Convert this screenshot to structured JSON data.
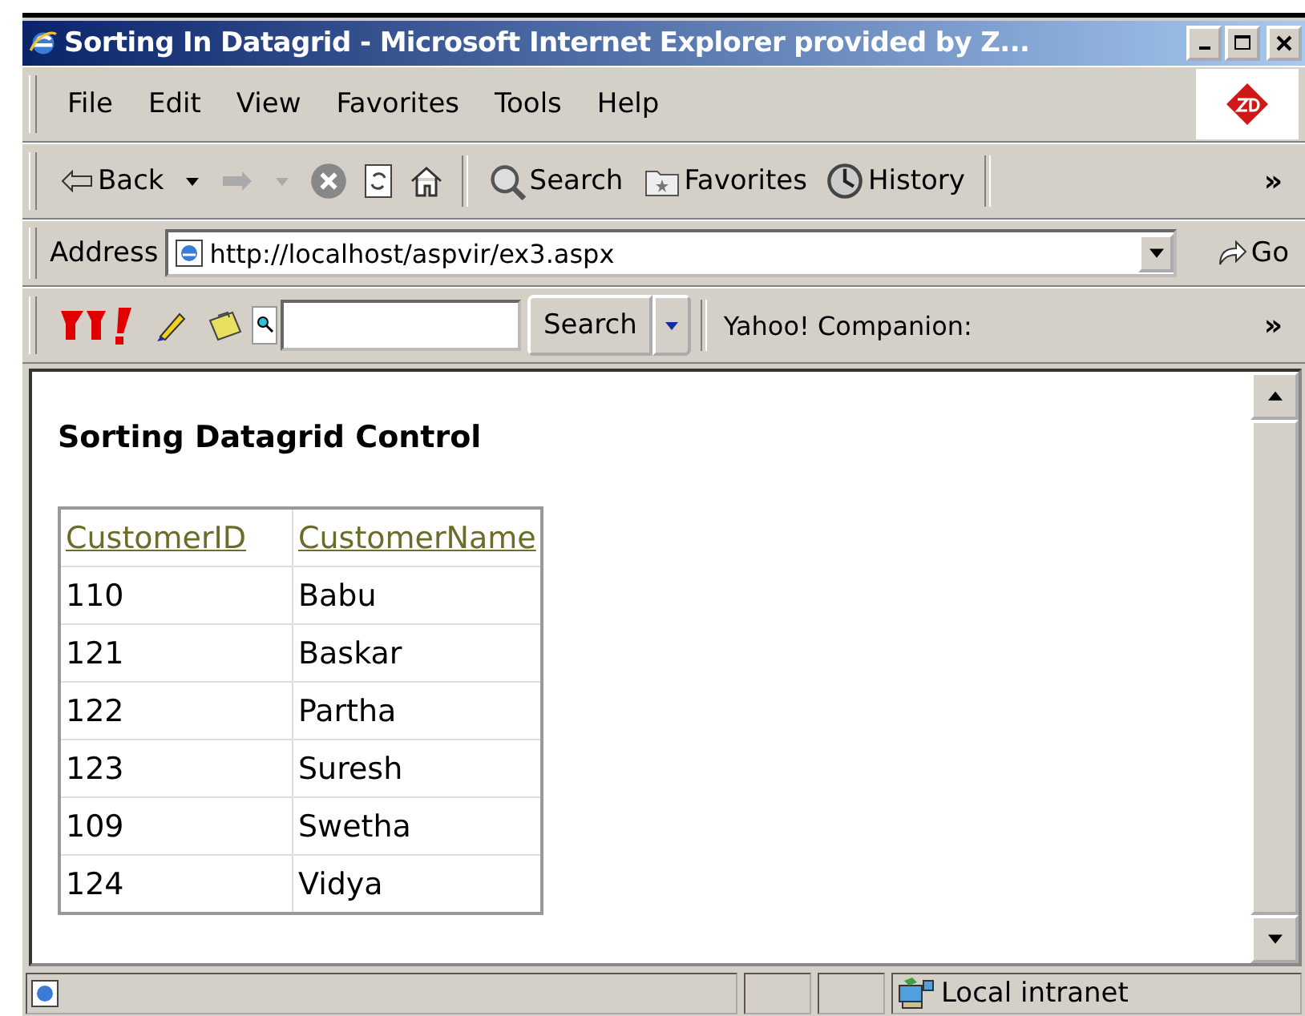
{
  "window": {
    "title": "Sorting In Datagrid - Microsoft Internet Explorer provided by Z..."
  },
  "menu": [
    "File",
    "Edit",
    "View",
    "Favorites",
    "Tools",
    "Help"
  ],
  "toolbar": {
    "back": "Back",
    "search": "Search",
    "favorites": "Favorites",
    "history": "History",
    "more": "»"
  },
  "address": {
    "label": "Address",
    "url": "http://localhost/aspvir/ex3.aspx",
    "go": "Go"
  },
  "links_bar": {
    "search_button": "Search",
    "companion": "Yahoo! Companion:",
    "more": "»"
  },
  "page": {
    "heading": "Sorting Datagrid Control",
    "table": {
      "columns": [
        "CustomerID",
        "CustomerName"
      ],
      "rows": [
        [
          "110",
          "Babu"
        ],
        [
          "121",
          "Baskar"
        ],
        [
          "122",
          "Partha"
        ],
        [
          "123",
          "Suresh"
        ],
        [
          "109",
          "Swetha"
        ],
        [
          "124",
          "Vidya"
        ]
      ]
    }
  },
  "status_bar": {
    "zone": "Local intranet"
  }
}
